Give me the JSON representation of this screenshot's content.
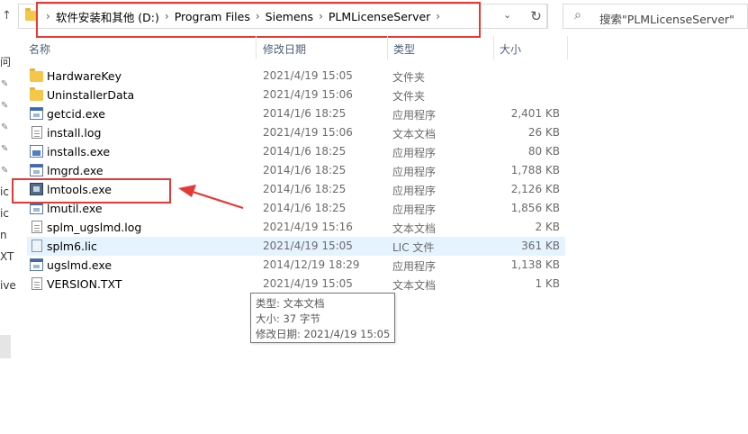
{
  "address": {
    "crumbs": [
      "软件安装和其他 (D:)",
      "Program Files",
      "Siemens",
      "PLMLicenseServer"
    ],
    "search_placeholder": "搜索\"PLMLicenseServer\""
  },
  "nav": {
    "fragments": [
      "问",
      "ic",
      "ic",
      "n",
      "XT",
      "ive"
    ]
  },
  "columns": {
    "name": "名称",
    "date": "修改日期",
    "type": "类型",
    "size": "大小"
  },
  "files": [
    {
      "name": "HardwareKey",
      "date": "2021/4/19 15:05",
      "type": "文件夹",
      "size": "",
      "icon": "folder-icon"
    },
    {
      "name": "UninstallerData",
      "date": "2021/4/19 15:06",
      "type": "文件夹",
      "size": "",
      "icon": "folder-icon"
    },
    {
      "name": "getcid.exe",
      "date": "2014/1/6 18:25",
      "type": "应用程序",
      "size": "2,401 KB",
      "icon": "exe-icon"
    },
    {
      "name": "install.log",
      "date": "2021/4/19 15:06",
      "type": "文本文档",
      "size": "26 KB",
      "icon": "text-file-icon"
    },
    {
      "name": "installs.exe",
      "date": "2014/1/6 18:25",
      "type": "应用程序",
      "size": "80 KB",
      "icon": "installer-icon"
    },
    {
      "name": "lmgrd.exe",
      "date": "2014/1/6 18:25",
      "type": "应用程序",
      "size": "1,788 KB",
      "icon": "exe-icon"
    },
    {
      "name": "lmtools.exe",
      "date": "2014/1/6 18:25",
      "type": "应用程序",
      "size": "2,126 KB",
      "icon": "lmtools-icon"
    },
    {
      "name": "lmutil.exe",
      "date": "2014/1/6 18:25",
      "type": "应用程序",
      "size": "1,856 KB",
      "icon": "exe-icon"
    },
    {
      "name": "splm_ugslmd.log",
      "date": "2021/4/19 15:16",
      "type": "文本文档",
      "size": "2 KB",
      "icon": "text-file-icon"
    },
    {
      "name": "splm6.lic",
      "date": "2021/4/19 15:05",
      "type": "LIC 文件",
      "size": "361 KB",
      "icon": "lic-file-icon"
    },
    {
      "name": "ugslmd.exe",
      "date": "2014/12/19 18:29",
      "type": "应用程序",
      "size": "1,138 KB",
      "icon": "exe-icon"
    },
    {
      "name": "VERSION.TXT",
      "date": "2021/4/19 15:05",
      "type": "文本文档",
      "size": "1 KB",
      "icon": "text-file-icon"
    }
  ],
  "tooltip": {
    "type_line": "类型: 文本文档",
    "size_line": "大小: 37 字节",
    "date_line": "修改日期: 2021/4/19 15:05"
  },
  "colors": {
    "highlight_red": "#e53935",
    "selected_row": "#e5f3ff"
  }
}
